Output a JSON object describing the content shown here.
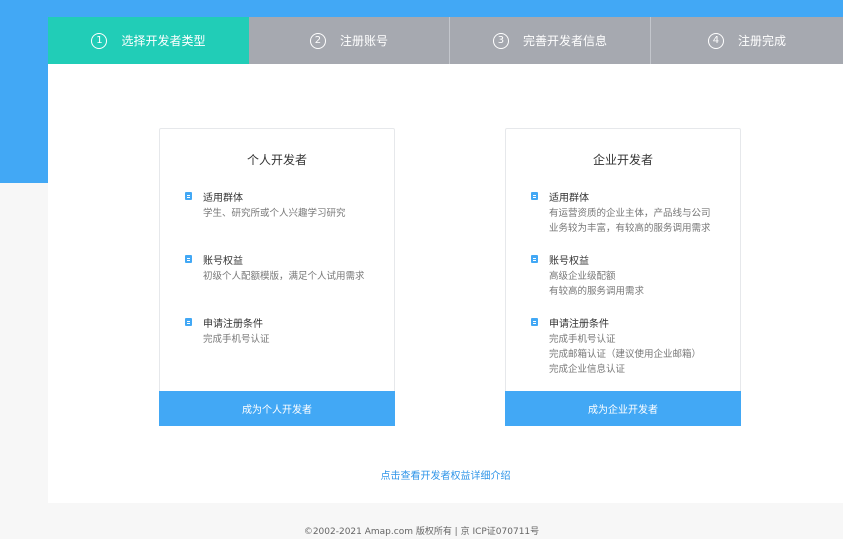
{
  "steps": [
    {
      "num": "1",
      "label": "选择开发者类型"
    },
    {
      "num": "2",
      "label": "注册账号"
    },
    {
      "num": "3",
      "label": "完善开发者信息"
    },
    {
      "num": "4",
      "label": "注册完成"
    }
  ],
  "cards": {
    "personal": {
      "title": "个人开发者",
      "sections": [
        {
          "heading": "适用群体",
          "lines": [
            "学生、研究所或个人兴趣学习研究"
          ]
        },
        {
          "heading": "账号权益",
          "lines": [
            "初级个人配额模版，满足个人试用需求"
          ]
        },
        {
          "heading": "申请注册条件",
          "lines": [
            "完成手机号认证"
          ]
        }
      ],
      "cta": "成为个人开发者"
    },
    "enterprise": {
      "title": "企业开发者",
      "sections": [
        {
          "heading": "适用群体",
          "lines": [
            "有运营资质的企业主体，产品线与公司",
            "业务较为丰富，有较高的服务调用需求"
          ]
        },
        {
          "heading": "账号权益",
          "lines": [
            "高级企业级配额",
            "有较高的服务调用需求"
          ]
        },
        {
          "heading": "申请注册条件",
          "lines": [
            "完成手机号认证",
            "完成邮箱认证（建议使用企业邮箱）",
            "完成企业信息认证"
          ]
        }
      ],
      "cta": "成为企业开发者"
    }
  },
  "detail_link": "点击查看开发者权益详细介绍",
  "footer": "©2002-2021 Amap.com 版权所有 | 京 ICP证070711号",
  "colors": {
    "primary": "#42a8f5",
    "active_step": "#21cdb7",
    "inactive_step": "#a6a9b0"
  },
  "icons": {
    "section": "document-icon"
  }
}
